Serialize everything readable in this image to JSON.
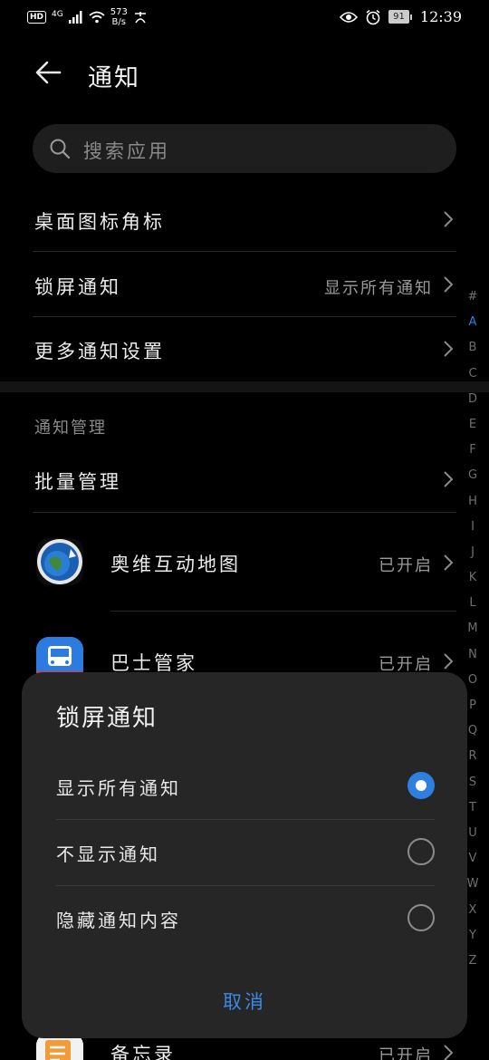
{
  "status_bar": {
    "hd": "HD",
    "network": "4G",
    "speed_value": "573",
    "speed_unit": "B/s",
    "battery": "91",
    "time": "12:39"
  },
  "header": {
    "title": "通知"
  },
  "search": {
    "placeholder": "搜索应用"
  },
  "settings": {
    "badge": "桌面图标角标",
    "lockscreen": "锁屏通知",
    "lockscreen_value": "显示所有通知",
    "more": "更多通知设置"
  },
  "section": {
    "title": "通知管理"
  },
  "batch": "批量管理",
  "apps": [
    {
      "name": "奥维互动地图",
      "status": "已开启"
    },
    {
      "name": "巴士管家",
      "status": "已开启"
    },
    {
      "name": "备忘录",
      "status": "已开启"
    }
  ],
  "alphabet": [
    "#",
    "A",
    "B",
    "C",
    "D",
    "E",
    "F",
    "G",
    "H",
    "I",
    "J",
    "K",
    "L",
    "M",
    "N",
    "O",
    "P",
    "Q",
    "R",
    "S",
    "T",
    "U",
    "V",
    "W",
    "X",
    "Y",
    "Z"
  ],
  "alphabet_active": "A",
  "dialog": {
    "title": "锁屏通知",
    "options": [
      {
        "label": "显示所有通知",
        "selected": true
      },
      {
        "label": "不显示通知",
        "selected": false
      },
      {
        "label": "隐藏通知内容",
        "selected": false
      }
    ],
    "cancel": "取消"
  },
  "colors": {
    "accent": "#2f7fe0",
    "background": "#000000",
    "dialog": "#262626"
  }
}
